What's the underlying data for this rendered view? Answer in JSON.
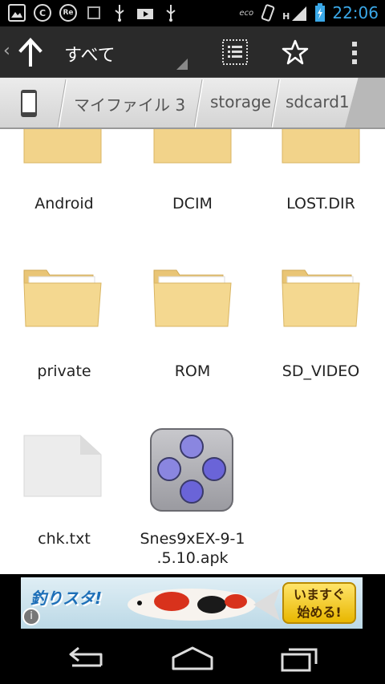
{
  "status_bar": {
    "time": "22:06",
    "icons": [
      "gallery-icon",
      "c-app-icon",
      "re-app-icon",
      "notification-icon",
      "usb-icon",
      "youtube-icon",
      "usb-icon",
      "eco-icon",
      "vibrate-icon",
      "signal-icon",
      "battery-icon"
    ],
    "left_texts": {
      "re": "Re",
      "c": "C"
    },
    "signal_label": "H",
    "eco_label": "eco"
  },
  "action_bar": {
    "title": "すべて"
  },
  "breadcrumb": {
    "items": [
      "マイファイル 3",
      "storage",
      "sdcard1"
    ]
  },
  "files": [
    {
      "name": "Android",
      "type": "folder"
    },
    {
      "name": "DCIM",
      "type": "folder"
    },
    {
      "name": "LOST.DIR",
      "type": "folder"
    },
    {
      "name": "private",
      "type": "folder"
    },
    {
      "name": "ROM",
      "type": "folder"
    },
    {
      "name": "SD_VIDEO",
      "type": "folder"
    },
    {
      "name": "chk.txt",
      "type": "text"
    },
    {
      "name_line1": "Snes9xEX-9-1",
      "name_line2": ".5.10.apk",
      "type": "apk"
    }
  ],
  "ad": {
    "logo": "釣りスタ!",
    "button_line1": "いますぐ",
    "button_line2": "始める!",
    "info": "i"
  },
  "colors": {
    "accent": "#3aa8e8",
    "folder": "#f2d38a",
    "actionbar": "#2a2a2a"
  }
}
